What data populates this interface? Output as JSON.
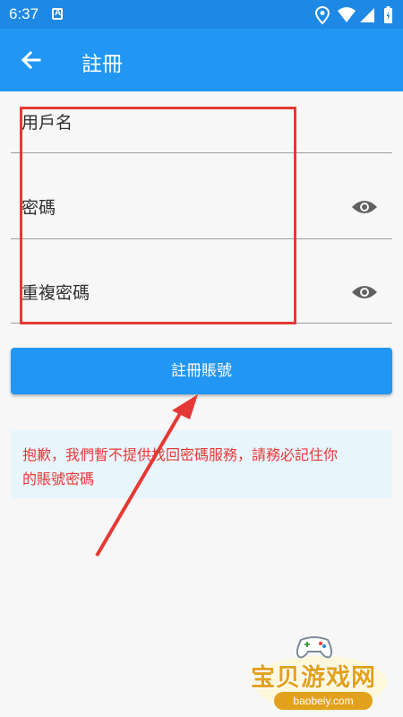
{
  "status_bar": {
    "time": "6:37",
    "app_icon": "a-icon",
    "icons": [
      "location-icon",
      "wifi-icon",
      "signal-icon",
      "battery-charging-icon"
    ]
  },
  "app_bar": {
    "title": "註冊",
    "back_icon": "arrow-left-icon",
    "color": "#2196f3"
  },
  "form": {
    "username": {
      "label": "用戶名"
    },
    "password": {
      "label": "密碼",
      "toggle_icon": "eye-icon"
    },
    "confirm_password": {
      "label": "重複密碼",
      "toggle_icon": "eye-icon"
    }
  },
  "register_button": {
    "label": "註冊賬號"
  },
  "notice": {
    "line1": "抱歉，我們暫不提供找回密碼服務，請務必記住你",
    "line2": "的賬號密碼",
    "color": "#e53935",
    "background": "#e9f5fd"
  },
  "annotation": {
    "box_color": "#e53935",
    "arrow_color": "#e53935"
  },
  "watermark": {
    "title": "宝贝游戏网",
    "url": "baobeiy.com"
  }
}
